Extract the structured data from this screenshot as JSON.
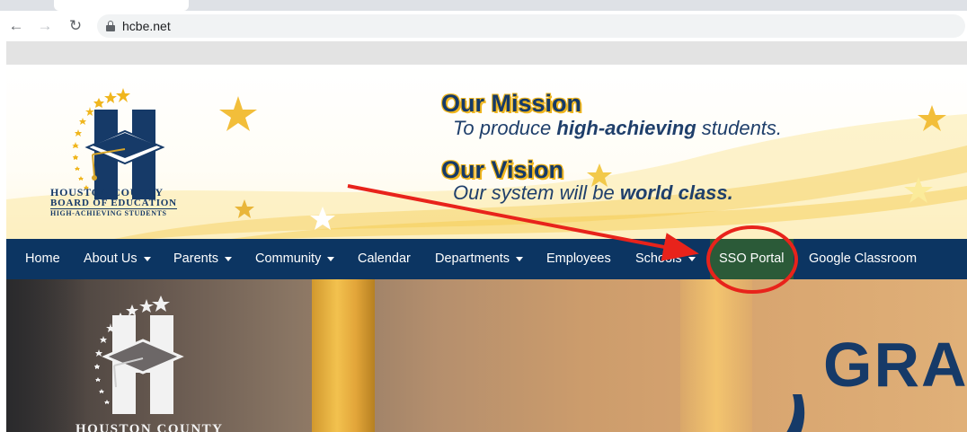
{
  "browser": {
    "url": "hcbe.net",
    "back_icon": "arrow-left-icon",
    "forward_icon": "arrow-right-icon",
    "reload_icon": "reload-icon",
    "lock_icon": "lock-icon"
  },
  "header": {
    "org_name_line1": "Houston County",
    "org_name_line2": "Board of Education",
    "org_tagline": "High-Achieving Students",
    "mission_heading": "Our Mission",
    "mission_text_pre": "To produce ",
    "mission_text_bold": "high-achieving",
    "mission_text_post": " students.",
    "vision_heading": "Our Vision",
    "vision_text_pre": "Our system will be ",
    "vision_text_bold": "world class."
  },
  "nav": {
    "items": [
      {
        "label": "Home",
        "dropdown": false
      },
      {
        "label": "About Us",
        "dropdown": true
      },
      {
        "label": "Parents",
        "dropdown": true
      },
      {
        "label": "Community",
        "dropdown": true
      },
      {
        "label": "Calendar",
        "dropdown": false
      },
      {
        "label": "Departments",
        "dropdown": true
      },
      {
        "label": "Employees",
        "dropdown": false
      },
      {
        "label": "Schools",
        "dropdown": true
      },
      {
        "label": "SSO Portal",
        "dropdown": false,
        "highlighted": true
      },
      {
        "label": "Google Classroom",
        "dropdown": false
      }
    ]
  },
  "hero": {
    "org_name": "Houston County",
    "title_partial": "GRA"
  },
  "colors": {
    "navy": "#0c3562",
    "gold": "#f0b61e",
    "active_nav": "#2b5a38",
    "annotation_red": "#e8231b"
  }
}
